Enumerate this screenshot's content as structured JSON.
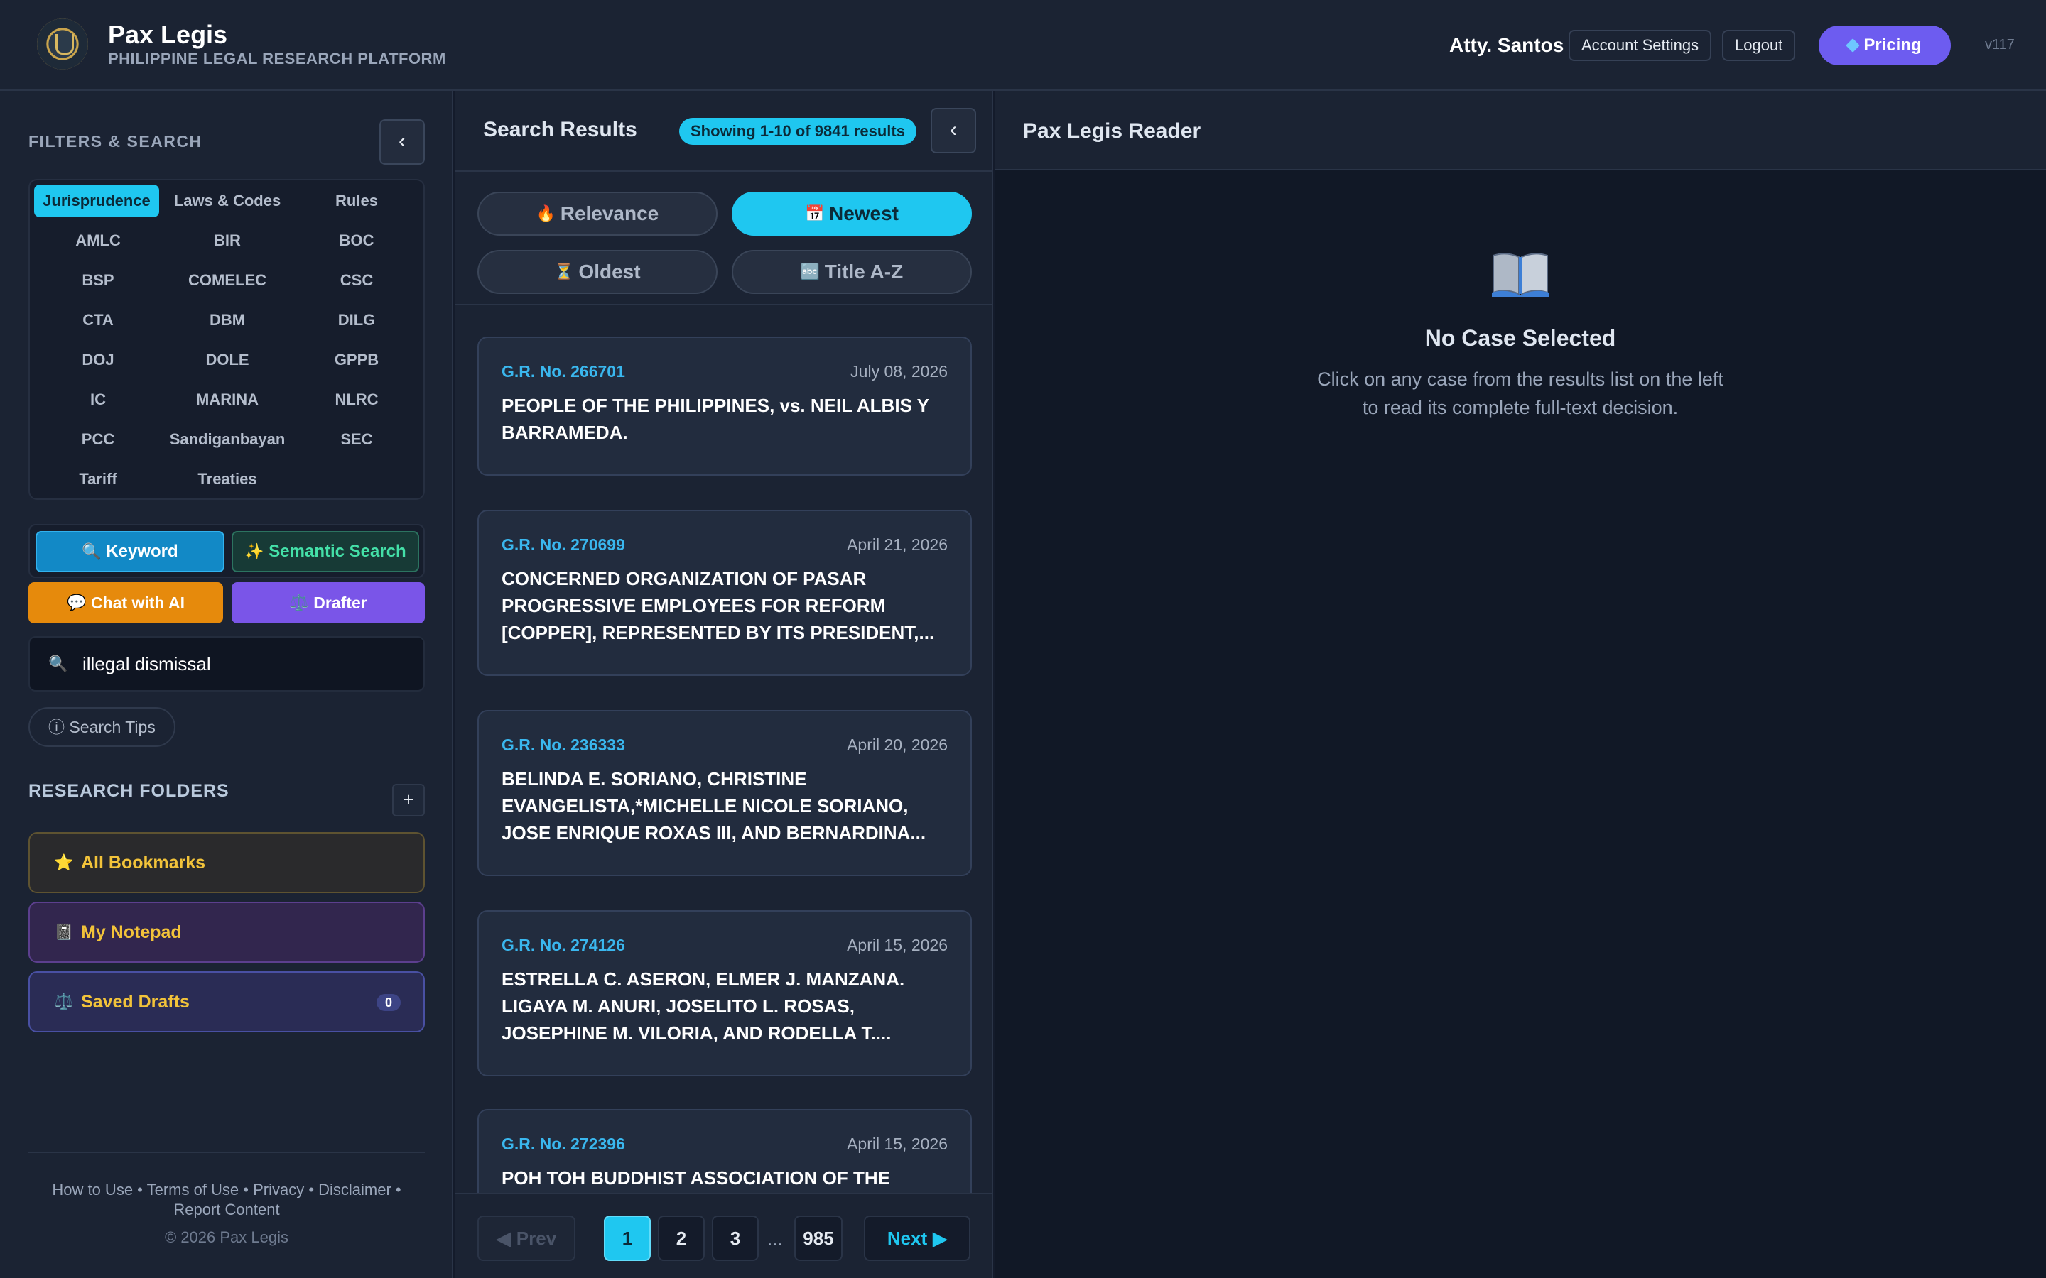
{
  "header": {
    "app_title": "Pax Legis",
    "app_subtitle": "PHILIPPINE LEGAL RESEARCH PLATFORM",
    "user_name": "Atty. Santos",
    "account_settings": "Account Settings",
    "logout": "Logout",
    "pricing": "Pricing",
    "version": "v117"
  },
  "sidebar": {
    "filters_title": "FILTERS & SEARCH",
    "collapse_icon": "‹",
    "filter_tabs": [
      "Jurisprudence",
      "Laws & Codes",
      "Rules",
      "AMLC",
      "BIR",
      "BOC",
      "BSP",
      "COMELEC",
      "CSC",
      "CTA",
      "DBM",
      "DILG",
      "DOJ",
      "DOLE",
      "GPPB",
      "IC",
      "MARINA",
      "NLRC",
      "PCC",
      "Sandiganbayan",
      "SEC",
      "Tariff",
      "Treaties"
    ],
    "active_filter": "Jurisprudence",
    "search_modes": {
      "keyword": "Keyword",
      "semantic": "Semantic Search"
    },
    "chat_ai": "Chat with AI",
    "drafter": "Drafter",
    "search_value": "illegal dismissal",
    "search_tips": "ⓘ Search Tips",
    "research_folders_title": "RESEARCH FOLDERS",
    "add_folder": "+",
    "folders": {
      "bookmarks": "All Bookmarks",
      "notepad": "My Notepad",
      "drafts": "Saved Drafts",
      "drafts_count": "0"
    },
    "footer_links": "How to Use • Terms of Use • Privacy • Disclaimer • Report Content",
    "copyright": "© 2026 Pax Legis"
  },
  "results": {
    "title": "Search Results",
    "count_badge": "Showing 1-10 of 9841 results",
    "collapse_icon": "‹",
    "sort": {
      "relevance": "Relevance",
      "newest": "Newest",
      "oldest": "Oldest",
      "title_az": "Title A-Z",
      "active": "Newest"
    },
    "cases": [
      {
        "gr": "G.R. No. 266701",
        "date": "July 08, 2026",
        "title": "PEOPLE OF THE PHILIPPINES, vs. NEIL ALBIS Y BARRAMEDA."
      },
      {
        "gr": "G.R. No. 270699",
        "date": "April 21, 2026",
        "title": "CONCERNED ORGANIZATION OF PASAR PROGRESSIVE EMPLOYEES FOR REFORM [COPPER], REPRESENTED BY ITS PRESIDENT,..."
      },
      {
        "gr": "G.R. No. 236333",
        "date": "April 20, 2026",
        "title": "BELINDA E. SORIANO, CHRISTINE EVANGELISTA,*MICHELLE NICOLE SORIANO, JOSE ENRIQUE ROXAS III, AND BERNARDINA..."
      },
      {
        "gr": "G.R. No. 274126",
        "date": "April 15, 2026",
        "title": "ESTRELLA C. ASERON, ELMER J. MANZANA. LIGAYA M. ANURI, JOSELITO L. ROSAS, JOSEPHINE M. VILORIA, AND RODELLA T...."
      },
      {
        "gr": "G.R. No. 272396",
        "date": "April 15, 2026",
        "title": "POH TOH BUDDHIST ASSOCIATION OF THE"
      }
    ],
    "pagination": {
      "prev": "Prev",
      "pages": [
        "1",
        "2",
        "3"
      ],
      "ellipsis": "...",
      "last": "985",
      "current": "1",
      "next": "Next"
    }
  },
  "reader": {
    "title": "Pax Legis Reader",
    "empty_title": "No Case Selected",
    "empty_text": "Click on any case from the results list on the left to read its complete full-text decision."
  },
  "colors": {
    "accent": "#1fc7f0",
    "pricing": "#6d5cf0",
    "chat": "#e68a0c",
    "drafter": "#7a55e8",
    "folder_text": "#f2c33a"
  }
}
